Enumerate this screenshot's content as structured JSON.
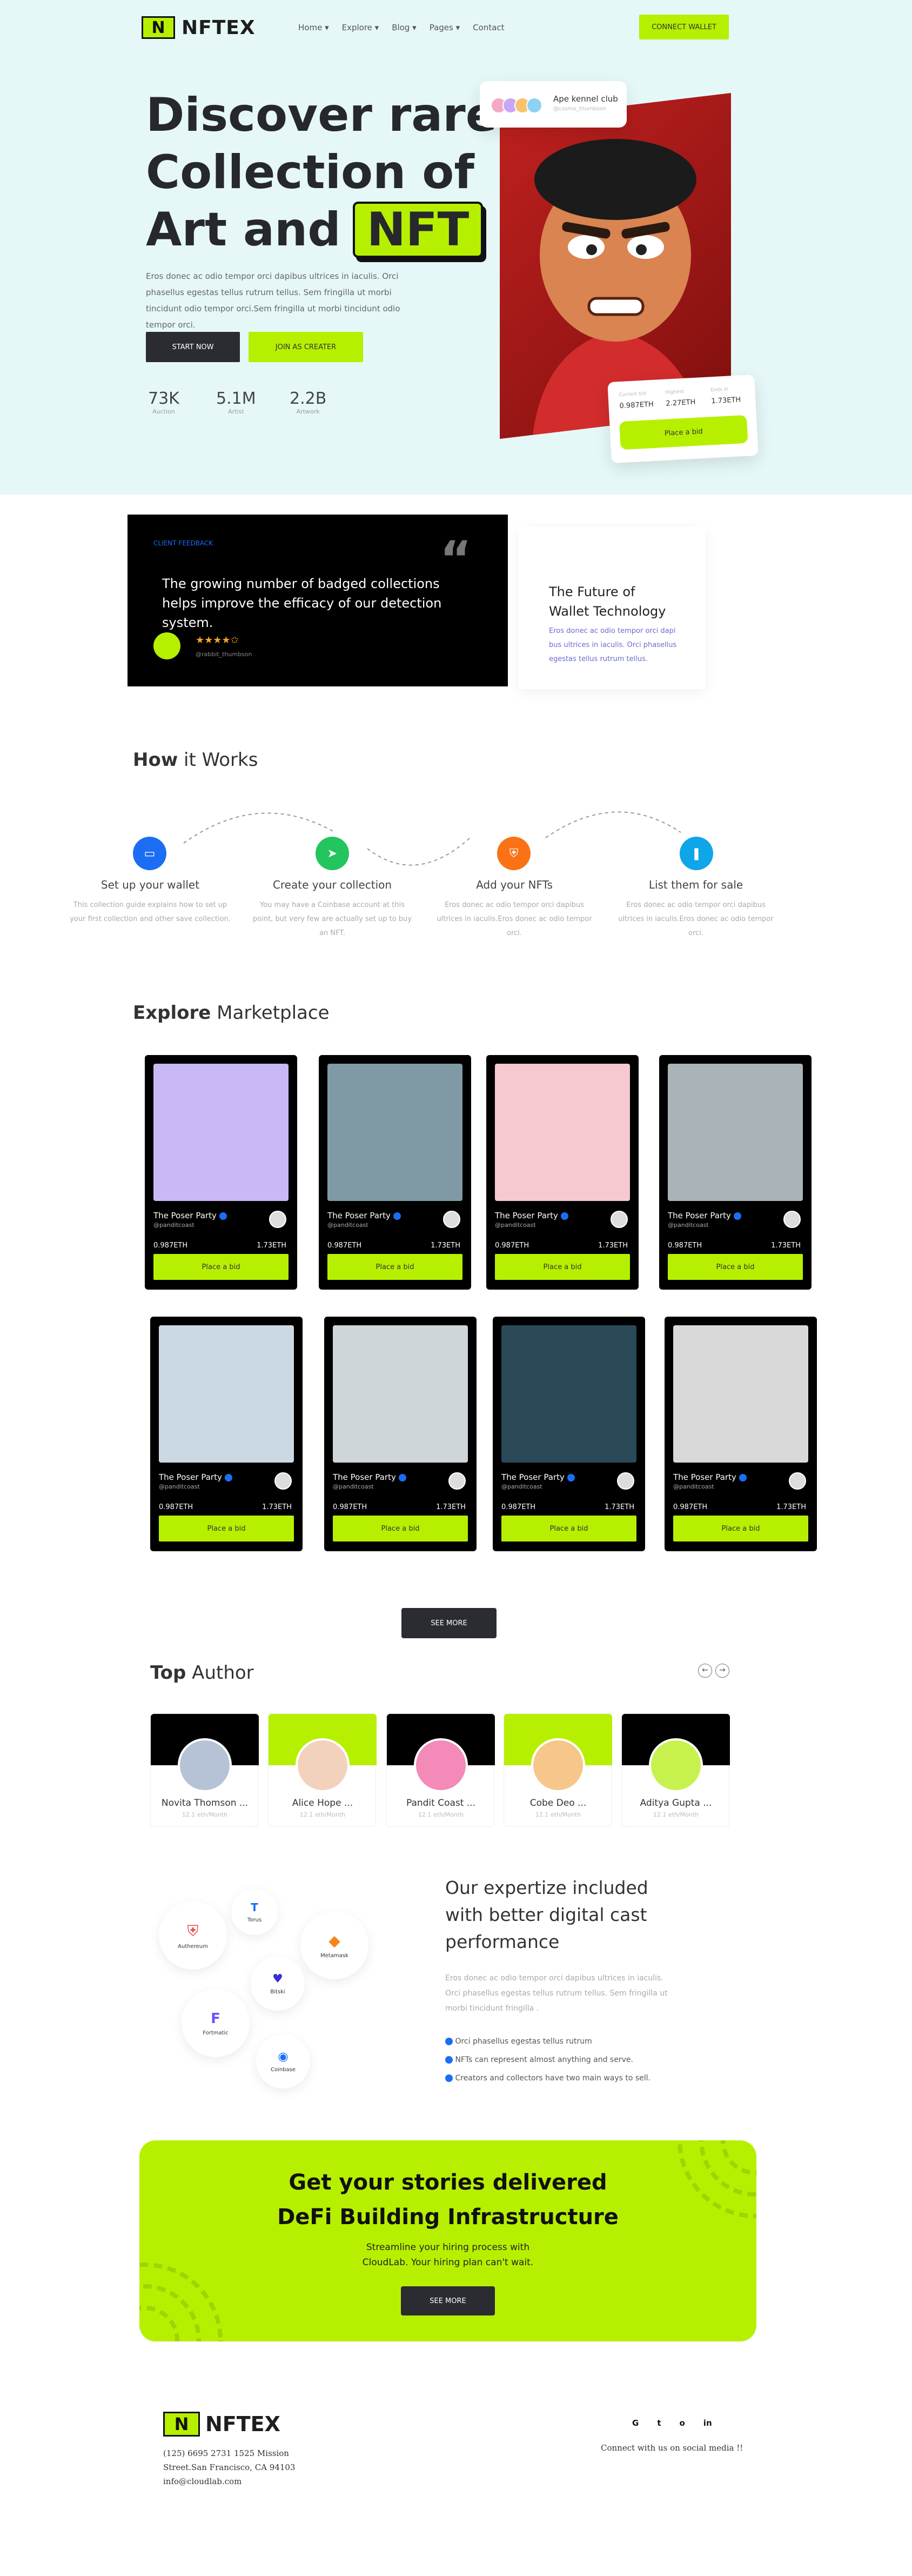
{
  "brand": {
    "name": "NFTEX",
    "mark": "N"
  },
  "nav": {
    "items": [
      "Home",
      "Explore",
      "Blog",
      "Pages",
      "Contact"
    ],
    "cta": "CONNECT WALLET"
  },
  "hero": {
    "title_lines": [
      "Discover rare",
      "Collection of",
      "Art and"
    ],
    "title_highlight": "NFT",
    "description": "Eros donec ac odio tempor orci dapibus ultrices in iaculis. Orci phasellus egestas tellus rutrum tellus. Sem fringilla ut morbi tincidunt odio tempor orci.Sem fringilla ut morbi tincidunt odio tempor orci.",
    "btn_primary": "START NOW",
    "btn_secondary": "JOIN AS CREATER",
    "stats": [
      {
        "value": "73K",
        "label": "Auction"
      },
      {
        "value": "5.1M",
        "label": "Artist"
      },
      {
        "value": "2.2B",
        "label": "Artwork"
      }
    ],
    "badge_title": "Ape kennel club",
    "badge_sub": "@cosmo_thumbson",
    "bid_card": {
      "stats": [
        {
          "label": "Current bid",
          "value": "0.987ETH"
        },
        {
          "label": "Highest",
          "value": "2.27ETH"
        },
        {
          "label": "Ends in",
          "value": "1.73ETH"
        }
      ],
      "button": "Place a bid"
    }
  },
  "feedback": {
    "eyebrow": "CLIENT FEEDBACK",
    "quote": "The growing number of badged collections helps improve the efficacy of our detection system.",
    "author": "@rabbit_thumbson",
    "side_title": "The Future of Wallet Technology",
    "side_text": "Eros donec ac odio tempor orci dapi bus ultrices in iaculis. Orci phasellus egestas tellus rutrum tellus."
  },
  "how": {
    "title_bold": "How",
    "title_rest": " it Works",
    "steps": [
      {
        "title": "Set up your wallet",
        "desc": "This collection guide explains how to set up your first collection and other save collection."
      },
      {
        "title": "Create your collection",
        "desc": "You may have a Coinbase account at this point, but very few are actually set up to buy an NFT."
      },
      {
        "title": "Add your NFTs",
        "desc": "Eros donec ac odio tempor orci dapibus ultrices in iaculis.Eros donec ac odio tempor orci."
      },
      {
        "title": "List them for sale",
        "desc": "Eros donec ac odio tempor orci dapibus ultrices in iaculis.Eros donec ac odio tempor orci."
      }
    ],
    "colors": [
      "#1b6ef3",
      "#22c55e",
      "#f97316",
      "#0ea5e9"
    ]
  },
  "market": {
    "title_bold": "Explore",
    "title_rest": " Marketplace",
    "card": {
      "name": "The Poser Party",
      "user": "@panditcoast",
      "price_left": "0.987ETH",
      "price_right": "1.73ETH",
      "button": "Place a bid"
    },
    "see_more": "SEE MORE"
  },
  "authors": {
    "title_bold": "Top",
    "title_rest": " Author",
    "items": [
      {
        "name": "Novita Thomson ...",
        "sub": "12.1 eth/Month"
      },
      {
        "name": "Alice Hope ...",
        "sub": "12.1 eth/Month"
      },
      {
        "name": "Pandit Coast ...",
        "sub": "12.1 eth/Month"
      },
      {
        "name": "Cobe Deo ...",
        "sub": "12.1 eth/Month"
      },
      {
        "name": "Aditya Gupta ...",
        "sub": "12.1 eth/Month"
      }
    ]
  },
  "expertise": {
    "title": "Our expertize included with better digital cast performance",
    "text": "Eros donec ac odio tempor orci dapibus ultrices in iaculis. Orci phasellus egestas tellus rutrum tellus. Sem fringilla ut morbi tincidunt fringilla .",
    "bullets": [
      "Orci phasellus egestas tellus rutrum",
      "NFTs can represent almost anything and serve.",
      "Creators and collectors have two main ways to sell."
    ],
    "wallets": [
      "Authereum",
      "Torus",
      "Metamask",
      "Bitski",
      "Fortmatic",
      "Coinbase"
    ]
  },
  "cta": {
    "line1": "Get your stories delivered",
    "line2": "DeFi Building Infrastructure",
    "sub1": "Streamline your hiring process with",
    "sub2": "CloudLab. Your hiring plan can't wait.",
    "button": "SEE MORE"
  },
  "footer": {
    "address1": "(125) 6695 2731 1525 Mission",
    "address2": "Street.San Francisco, CA 94103",
    "email": "info@cloudlab.com",
    "social_text": "Connect with us on social media !!",
    "socials": [
      "G",
      "t",
      "o",
      "in"
    ]
  }
}
